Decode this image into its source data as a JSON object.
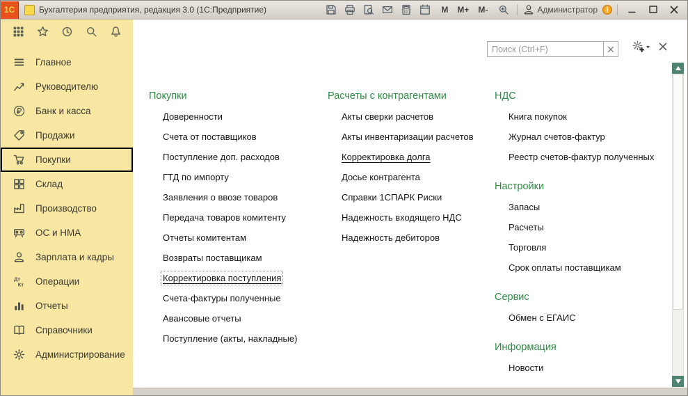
{
  "colors": {
    "accent_green": "#2e8b44",
    "sidebar_bg": "#f7e7a3",
    "logo_bg": "#e8511c",
    "logo_text_color": "#ffdf4f",
    "titlebar_top": "#ebe8e1",
    "titlebar_bottom": "#d2cec5",
    "selected_outline": "#000000"
  },
  "titlebar": {
    "logo_text": "1С",
    "title": "Бухгалтерия предприятия, редакция 3.0  (1С:Предприятие)",
    "tool_icons": [
      "save-icon",
      "print-icon",
      "print-preview-icon",
      "mail-icon",
      "calculator-icon",
      "calendar-icon"
    ],
    "memory_buttons": [
      "М",
      "М+",
      "М-"
    ],
    "zoom_icon": "zoom-in-icon",
    "user_icon": "user-icon",
    "user_label": "Администратор",
    "help_icon": "info-icon",
    "window_buttons": [
      "minimize",
      "maximize",
      "close"
    ]
  },
  "sidebar": {
    "top_icons": [
      "apps-grid-icon",
      "star-icon",
      "history-icon",
      "search-icon",
      "bell-icon"
    ],
    "items": [
      {
        "id": "main",
        "icon": "menu-icon",
        "label": "Главное"
      },
      {
        "id": "manager",
        "icon": "chart-icon",
        "label": "Руководителю"
      },
      {
        "id": "bank-cash",
        "icon": "ruble-icon",
        "label": "Банк и касса"
      },
      {
        "id": "sales",
        "icon": "sales-icon",
        "label": "Продажи"
      },
      {
        "id": "purchases",
        "icon": "cart-icon",
        "label": "Покупки",
        "selected": true
      },
      {
        "id": "warehouse",
        "icon": "warehouse-icon",
        "label": "Склад"
      },
      {
        "id": "production",
        "icon": "production-icon",
        "label": "Производство"
      },
      {
        "id": "fixed-assets",
        "icon": "assets-icon",
        "label": "ОС и НМА"
      },
      {
        "id": "salary-hr",
        "icon": "person-icon",
        "label": "Зарплата и кадры"
      },
      {
        "id": "operations",
        "icon": "dtkt-icon",
        "label": "Операции"
      },
      {
        "id": "reports",
        "icon": "reports-icon",
        "label": "Отчеты"
      },
      {
        "id": "directories",
        "icon": "books-icon",
        "label": "Справочники"
      },
      {
        "id": "administration",
        "icon": "gear-icon",
        "label": "Администрирование"
      }
    ]
  },
  "search": {
    "placeholder": "Поиск (Ctrl+F)"
  },
  "panel": {
    "columns": [
      {
        "sections": [
          {
            "id": "purchases",
            "title": "Покупки",
            "items": [
              {
                "label": "Доверенности"
              },
              {
                "label": "Счета от поставщиков"
              },
              {
                "label": "Поступление доп. расходов"
              },
              {
                "label": "ГТД по импорту"
              },
              {
                "label": "Заявления о ввозе товаров"
              },
              {
                "label": "Передача товаров комитенту"
              },
              {
                "label": "Отчеты комитентам"
              },
              {
                "label": "Возвраты поставщикам"
              },
              {
                "label": "Корректировка поступления",
                "state": "focused"
              },
              {
                "label": "Счета-фактуры полученные"
              },
              {
                "label": "Авансовые отчеты"
              },
              {
                "label": "Поступление (акты, накладные)"
              }
            ]
          }
        ]
      },
      {
        "sections": [
          {
            "id": "settlements",
            "title": "Расчеты с контрагентами",
            "items": [
              {
                "label": "Акты сверки расчетов"
              },
              {
                "label": "Акты инвентаризации расчетов"
              },
              {
                "label": "Корректировка долга",
                "state": "hovered"
              },
              {
                "label": "Досье контрагента"
              },
              {
                "label": "Справки 1СПАРК Риски"
              },
              {
                "label": "Надежность входящего НДС"
              },
              {
                "label": "Надежность дебиторов"
              }
            ]
          }
        ]
      },
      {
        "sections": [
          {
            "id": "vat",
            "title": "НДС",
            "items": [
              {
                "label": "Книга покупок"
              },
              {
                "label": "Журнал счетов-фактур"
              },
              {
                "label": "Реестр счетов-фактур полученных"
              }
            ]
          },
          {
            "id": "settings",
            "title": "Настройки",
            "items": [
              {
                "label": "Запасы"
              },
              {
                "label": "Расчеты"
              },
              {
                "label": "Торговля"
              },
              {
                "label": "Срок оплаты поставщикам"
              }
            ]
          },
          {
            "id": "service",
            "title": "Сервис",
            "items": [
              {
                "label": "Обмен с ЕГАИС"
              }
            ]
          },
          {
            "id": "information",
            "title": "Информация",
            "items": [
              {
                "label": "Новости"
              }
            ]
          }
        ]
      }
    ]
  }
}
